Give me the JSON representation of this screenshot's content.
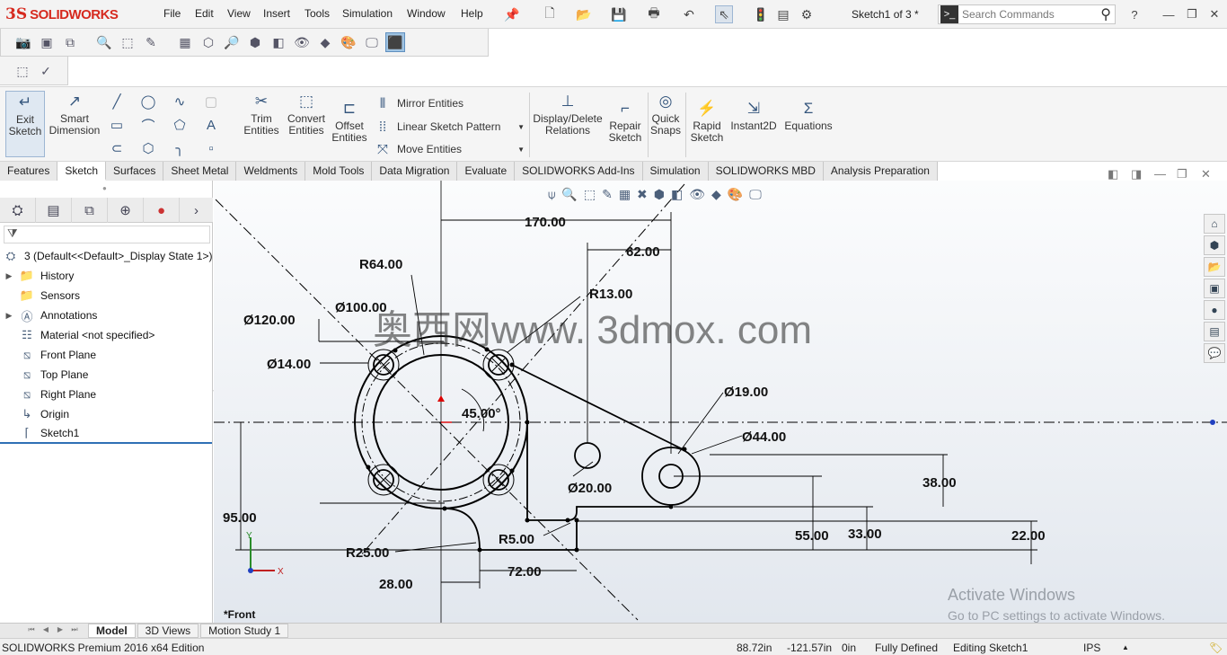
{
  "app": {
    "logo_mark": "3S",
    "logo_text": "SOLIDWORKS",
    "document_title": "Sketch1 of 3 *"
  },
  "menu": [
    "File",
    "Edit",
    "View",
    "Insert",
    "Tools",
    "Simulation",
    "Window",
    "Help"
  ],
  "search": {
    "placeholder": "Search Commands"
  },
  "ribbon": {
    "exit_sketch": "Exit\nSketch",
    "smart_dimension": "Smart\nDimension",
    "trim_entities": "Trim\nEntities",
    "convert_entities": "Convert\nEntities",
    "offset_entities": "Offset\nEntities",
    "mirror_entities": "Mirror Entities",
    "linear_sketch_pattern": "Linear Sketch Pattern",
    "move_entities": "Move Entities",
    "display_delete_relations": "Display/Delete\nRelations",
    "repair_sketch": "Repair\nSketch",
    "quick_snaps": "Quick\nSnaps",
    "rapid_sketch": "Rapid\nSketch",
    "instant2d": "Instant2D",
    "equations": "Equations"
  },
  "tabs": [
    "Features",
    "Sketch",
    "Surfaces",
    "Sheet Metal",
    "Weldments",
    "Mold Tools",
    "Data Migration",
    "Evaluate",
    "SOLIDWORKS Add-Ins",
    "Simulation",
    "SOLIDWORKS MBD",
    "Analysis Preparation"
  ],
  "active_tab": "Sketch",
  "tree": {
    "root": "3  (Default<<Default>_Display State 1>)",
    "items": [
      {
        "label": "History",
        "icon": "history-folder-icon",
        "expandable": true
      },
      {
        "label": "Sensors",
        "icon": "sensors-folder-icon",
        "expandable": false
      },
      {
        "label": "Annotations",
        "icon": "annotations-icon",
        "expandable": true
      },
      {
        "label": "Material <not specified>",
        "icon": "material-icon",
        "expandable": false
      },
      {
        "label": "Front Plane",
        "icon": "plane-icon",
        "expandable": false
      },
      {
        "label": "Top Plane",
        "icon": "plane-icon",
        "expandable": false
      },
      {
        "label": "Right Plane",
        "icon": "plane-icon",
        "expandable": false
      },
      {
        "label": "Origin",
        "icon": "origin-icon",
        "expandable": false
      },
      {
        "label": "Sketch1",
        "icon": "sketch-icon",
        "expandable": false
      }
    ]
  },
  "sketch": {
    "view_label": "*Front",
    "watermark": "奥西网www. 3dmox. com",
    "dimensions": {
      "d170": "170.00",
      "d62": "62.00",
      "r64": "R64.00",
      "r13": "R13.00",
      "dia100": "Ø100.00",
      "dia120": "Ø120.00",
      "dia14": "Ø14.00",
      "angle45": "45.00°",
      "dia19": "Ø19.00",
      "dia44": "Ø44.00",
      "dia20": "Ø20.00",
      "d38": "38.00",
      "d95": "95.00",
      "d55": "55.00",
      "d33": "33.00",
      "d22": "22.00",
      "r5": "R5.00",
      "r25": "R25.00",
      "d72": "72.00",
      "d28": "28.00"
    },
    "axis_x": "X",
    "axis_y": "Y"
  },
  "bottom_tabs": [
    "Model",
    "3D Views",
    "Motion Study 1"
  ],
  "active_bottom_tab": "Model",
  "status": {
    "edition": "SOLIDWORKS Premium 2016 x64 Edition",
    "x": "88.72in",
    "y": "-121.57in",
    "z": "0in",
    "state": "Fully Defined",
    "mode": "Editing Sketch1",
    "units": "IPS"
  },
  "activate_windows": {
    "title": "Activate Windows",
    "subtitle": "Go to PC settings to activate Windows."
  },
  "colors": {
    "brand": "#d62a1f",
    "sketch_line": "#000000",
    "accent": "#35567d"
  }
}
